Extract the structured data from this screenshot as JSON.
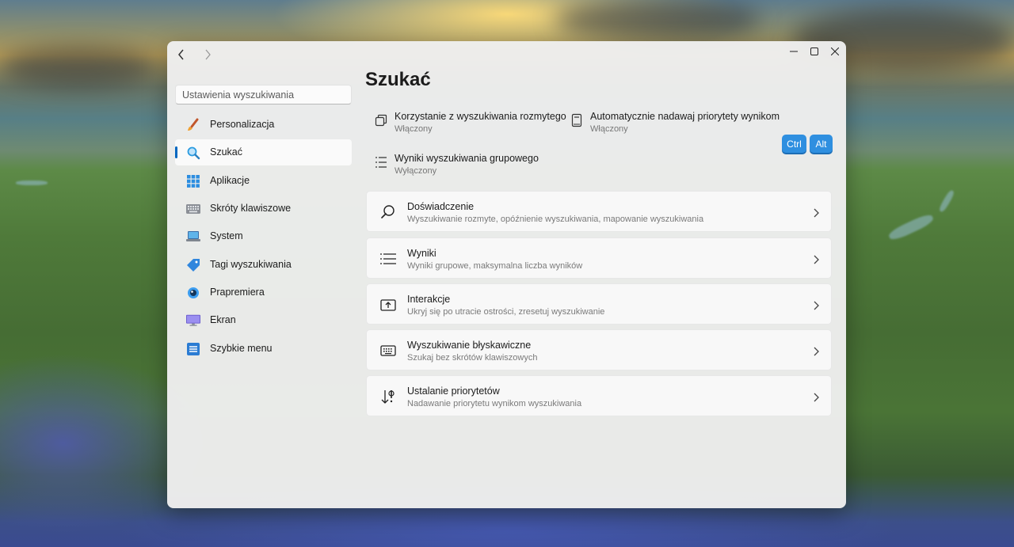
{
  "window": {
    "nav": {
      "back_icon": "chevron-left-icon",
      "forward_icon": "chevron-right-icon"
    },
    "controls": [
      "minimize-icon",
      "maximize-icon",
      "close-icon"
    ]
  },
  "sidebar": {
    "search_placeholder": "Ustawienia wyszukiwania",
    "items": [
      {
        "label": "Personalizacja",
        "icon": "paintbrush-icon"
      },
      {
        "label": "Szukać",
        "icon": "magnifier-icon",
        "active": true
      },
      {
        "label": "Aplikacje",
        "icon": "apps-grid-icon"
      },
      {
        "label": "Skróty klawiszowe",
        "icon": "keyboard-icon"
      },
      {
        "label": "System",
        "icon": "laptop-icon"
      },
      {
        "label": "Tagi wyszukiwania",
        "icon": "tag-icon"
      },
      {
        "label": "Prapremiera",
        "icon": "eye-icon"
      },
      {
        "label": "Ekran",
        "icon": "monitor-icon"
      },
      {
        "label": "Szybkie menu",
        "icon": "menu-list-icon"
      }
    ]
  },
  "main": {
    "title": "Szukać",
    "quick": [
      {
        "title": "Korzystanie z wyszukiwania rozmytego",
        "status": "Włączony",
        "icon": "copy-icon"
      },
      {
        "title": "Automatycznie nadawaj priorytety wynikom",
        "status": "Włączony",
        "icon": "notebook-icon"
      },
      {
        "title": "Wyniki wyszukiwania grupowego",
        "status": "Wyłączony",
        "icon": "list-icon"
      }
    ],
    "keys": [
      "Ctrl",
      "Alt"
    ],
    "cards": [
      {
        "title": "Doświadczenie",
        "subtitle": "Wyszukiwanie rozmyte, opóźnienie wyszukiwania, mapowanie wyszukiwania",
        "icon": "search-icon"
      },
      {
        "title": "Wyniki",
        "subtitle": "Wyniki grupowe, maksymalna liczba wyników",
        "icon": "list-lines-icon"
      },
      {
        "title": "Interakcje",
        "subtitle": "Ukryj się po utracie ostrości, zresetuj wyszukiwanie",
        "icon": "upload-box-icon"
      },
      {
        "title": "Wyszukiwanie błyskawiczne",
        "subtitle": "Szukaj bez skrótów klawiszowych",
        "icon": "keyboard-icon"
      },
      {
        "title": "Ustalanie priorytetów",
        "subtitle": "Nadawanie priorytetu wynikom wyszukiwania",
        "icon": "sort-priority-icon"
      }
    ]
  },
  "colors": {
    "accent": "#0067c0",
    "key_bg": "#2f8fe0"
  }
}
